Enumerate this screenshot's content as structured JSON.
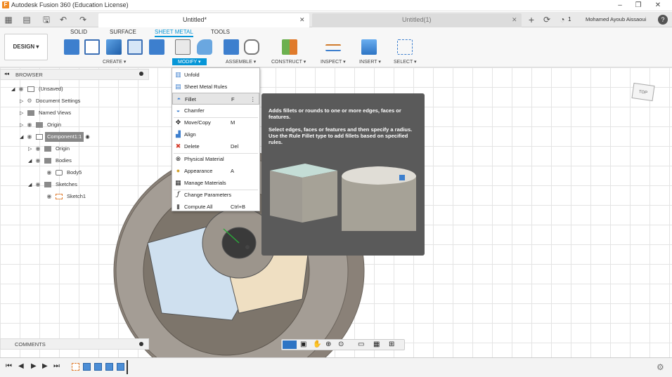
{
  "window": {
    "title": "Autodesk Fusion 360 (Education License)",
    "minimize": "–",
    "restore": "❐",
    "close": "✕"
  },
  "tabbar": {
    "active_tab": "Untitled*",
    "inactive_tab": "Untitled(1)",
    "close_glyph": "✕",
    "add_glyph": "+",
    "notification_count": "1",
    "user": "Mohamed Ayoub Aissaoui",
    "help": "?"
  },
  "ribbon": {
    "tabs": [
      "SOLID",
      "SURFACE",
      "SHEET METAL",
      "TOOLS"
    ],
    "active_tab": "SHEET METAL",
    "workspace": "DESIGN",
    "groups": [
      "CREATE",
      "MODIFY",
      "ASSEMBLE",
      "CONSTRUCT",
      "INSPECT",
      "INSERT",
      "SELECT"
    ]
  },
  "browser": {
    "title": "BROWSER",
    "items": [
      {
        "label": "(Unsaved)"
      },
      {
        "label": "Document Settings"
      },
      {
        "label": "Named Views"
      },
      {
        "label": "Origin"
      },
      {
        "label": "Component1:1"
      },
      {
        "label": "Origin"
      },
      {
        "label": "Bodies"
      },
      {
        "label": "Body5"
      },
      {
        "label": "Sketches"
      },
      {
        "label": "Sketch1"
      }
    ]
  },
  "modify_menu": {
    "items": [
      {
        "label": "Unfold",
        "shortcut": ""
      },
      {
        "label": "Sheet Metal Rules",
        "shortcut": ""
      },
      {
        "label": "Fillet",
        "shortcut": "F"
      },
      {
        "label": "Chamfer",
        "shortcut": ""
      },
      {
        "label": "Move/Copy",
        "shortcut": "M"
      },
      {
        "label": "Align",
        "shortcut": ""
      },
      {
        "label": "Delete",
        "shortcut": "Del"
      },
      {
        "label": "Physical Material",
        "shortcut": ""
      },
      {
        "label": "Appearance",
        "shortcut": "A"
      },
      {
        "label": "Manage Materials",
        "shortcut": ""
      },
      {
        "label": "Change Parameters",
        "shortcut": ""
      },
      {
        "label": "Compute All",
        "shortcut": "Ctrl+B"
      }
    ],
    "more_glyph": "⋮"
  },
  "tooltip": {
    "line1": "Adds fillets or rounds to one or more edges, faces or features.",
    "line2": "Select edges, faces or features and then specify a radius. Use the Rule Fillet type to add fillets based on specified rules."
  },
  "viewcube": {
    "face": "TOP"
  },
  "comments": {
    "title": "COMMENTS"
  },
  "colors": {
    "accent": "#0696d7",
    "tooltip_bg": "#5a5a5a",
    "body_color": "#8d877e"
  }
}
